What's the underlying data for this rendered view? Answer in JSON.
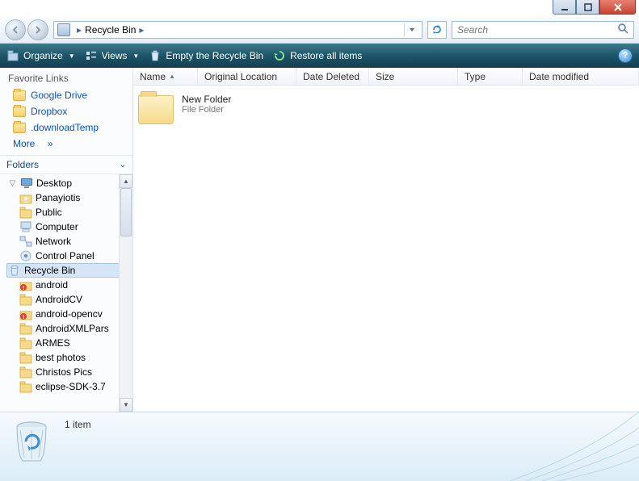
{
  "window": {
    "controls": {
      "minimize": "min",
      "maximize": "max",
      "close": "close"
    }
  },
  "address": {
    "path": [
      "Recycle Bin"
    ],
    "chevron": "▸"
  },
  "search": {
    "placeholder": "Search"
  },
  "toolbar": {
    "organize": "Organize",
    "views": "Views",
    "empty": "Empty the Recycle Bin",
    "restore": "Restore all items"
  },
  "favorites": {
    "header": "Favorite Links",
    "items": [
      {
        "label": "Google Drive"
      },
      {
        "label": "Dropbox"
      },
      {
        "label": ".downloadTemp"
      }
    ],
    "more": "More",
    "more_chev": "»"
  },
  "folders": {
    "header": "Folders",
    "tree": [
      {
        "label": "Desktop",
        "icon": "monitor",
        "indent": 0,
        "expanded": true
      },
      {
        "label": "Panayiotis",
        "icon": "user-folder",
        "indent": 1
      },
      {
        "label": "Public",
        "icon": "folder",
        "indent": 1
      },
      {
        "label": "Computer",
        "icon": "computer",
        "indent": 1
      },
      {
        "label": "Network",
        "icon": "network",
        "indent": 1
      },
      {
        "label": "Control Panel",
        "icon": "control",
        "indent": 1
      },
      {
        "label": "Recycle Bin",
        "icon": "recycle",
        "indent": 1,
        "selected": true
      },
      {
        "label": "android",
        "icon": "alert-folder",
        "indent": 1
      },
      {
        "label": "AndroidCV",
        "icon": "folder",
        "indent": 1
      },
      {
        "label": "android-opencv",
        "icon": "alert-folder",
        "indent": 1
      },
      {
        "label": "AndroidXMLPars",
        "icon": "folder",
        "indent": 1
      },
      {
        "label": "ARMES",
        "icon": "folder",
        "indent": 1
      },
      {
        "label": "best photos",
        "icon": "folder",
        "indent": 1
      },
      {
        "label": "Christos Pics",
        "icon": "folder",
        "indent": 1
      },
      {
        "label": "eclipse-SDK-3.7",
        "icon": "folder",
        "indent": 1
      }
    ]
  },
  "columns": {
    "name": "Name",
    "origloc": "Original Location",
    "deleted": "Date Deleted",
    "size": "Size",
    "type": "Type",
    "modified": "Date modified"
  },
  "files": [
    {
      "name": "New Folder",
      "type": "File Folder"
    }
  ],
  "status": {
    "count_text": "1 item"
  }
}
